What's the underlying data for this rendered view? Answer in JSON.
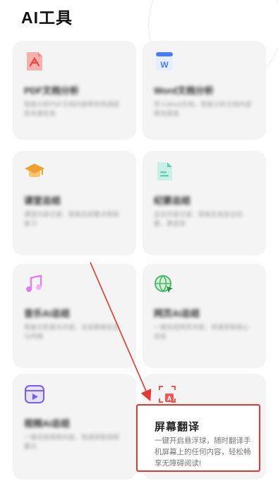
{
  "header": {
    "title": "AI工具"
  },
  "tools": [
    {
      "name": "PDF文档分析",
      "desc": "智能分析PDF文档内容帮你快速提炼关键信息",
      "icon": "pdf-icon",
      "color": "#f08a8a"
    },
    {
      "name": "Word文档分析",
      "desc": "导入Word文档，智能分析文档内容帮你提炼",
      "icon": "word-icon",
      "color": "#4a7ef0"
    },
    {
      "name": "课堂总结",
      "desc": "课堂内容记录，智能总结要点帮助复习",
      "icon": "graduation-cap-icon",
      "color": "#f0a030"
    },
    {
      "name": "纪要总结",
      "desc": "会议内容记录，智能生成会议纪要，更高效",
      "icon": "document-icon",
      "color": "#5fcfb8"
    },
    {
      "name": "音乐AI总结",
      "desc": "智能识别音乐内容，总结歌曲信息与风格",
      "icon": "music-note-icon",
      "color": "#e27fe6"
    },
    {
      "name": "网页AI总结",
      "desc": "一键总结网页内容，快速获取核心信息",
      "icon": "globe-icon",
      "color": "#4db86a"
    },
    {
      "name": "视频AI总结",
      "desc": "一键总结视频内容，快速获取视频要点",
      "icon": "video-play-icon",
      "color": "#7b5cf0"
    }
  ],
  "translate": {
    "name": "屏幕翻译",
    "desc": "一键开启悬浮球，随时翻译手机屏幕上的任何内容，轻松畅享无障碍阅读!",
    "icon": "screen-translate-icon",
    "highlight_color": "#e03a33"
  }
}
